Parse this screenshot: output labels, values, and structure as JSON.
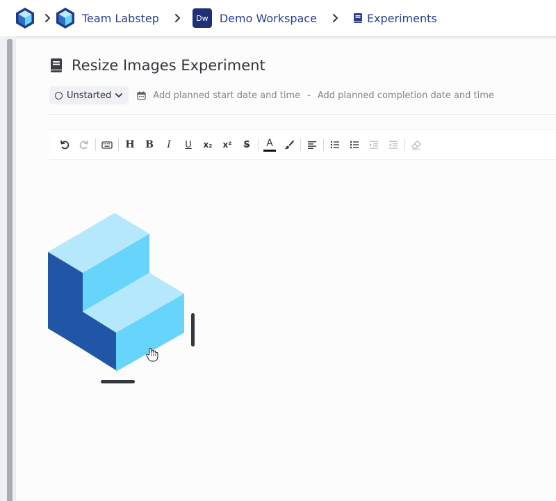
{
  "breadcrumb": {
    "team": "Team Labstep",
    "workspace_badge": "Dw",
    "workspace": "Demo Workspace",
    "section": "Experiments"
  },
  "experiment": {
    "title": "Resize Images Experiment",
    "status": "Unstarted",
    "start_placeholder": "Add planned start date and time",
    "separator": "-",
    "completion_placeholder": "Add planned completion date and time"
  },
  "toolbar": {
    "bold": "B",
    "heading": "H",
    "italic": "I",
    "underline": "U",
    "subscript": "x₂",
    "superscript": "x²",
    "strikethrough": "S",
    "text_color": "A"
  },
  "colors": {
    "brand": "#2b3e8c",
    "badge": "#1f2f78",
    "cube_light": "#66d4fb",
    "cube_top": "#b5e8fc",
    "cube_dark": "#2156a6"
  }
}
